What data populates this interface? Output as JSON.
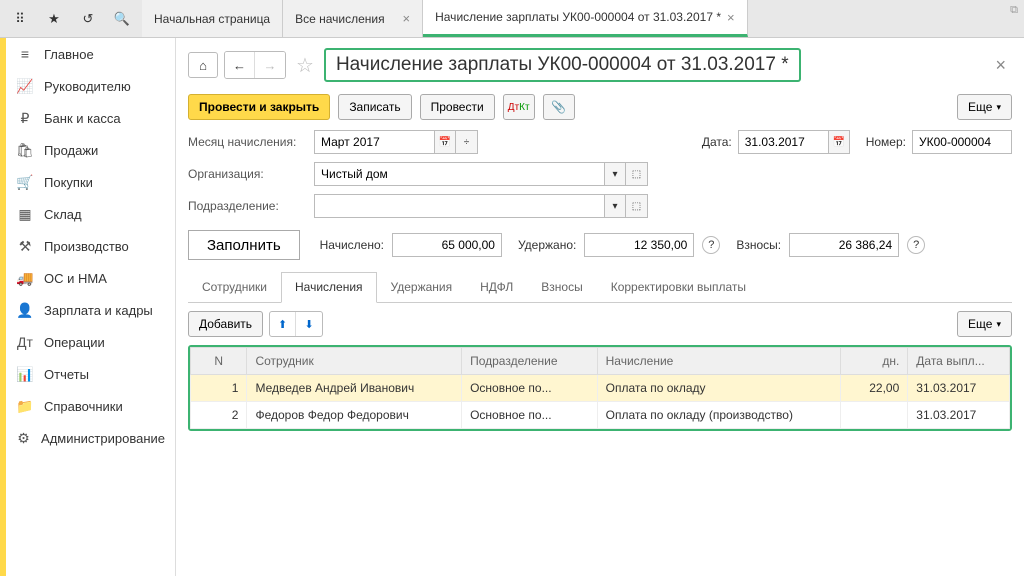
{
  "topTabs": [
    {
      "label": "Начальная страница"
    },
    {
      "label": "Все начисления"
    },
    {
      "label": "Начисление зарплаты УК00-000004 от 31.03.2017 *",
      "active": true
    }
  ],
  "sidebar": [
    {
      "icon": "≡",
      "label": "Главное"
    },
    {
      "icon": "📈",
      "label": "Руководителю"
    },
    {
      "icon": "₽",
      "label": "Банк и касса"
    },
    {
      "icon": "🛍",
      "label": "Продажи"
    },
    {
      "icon": "🛒",
      "label": "Покупки"
    },
    {
      "icon": "▦",
      "label": "Склад"
    },
    {
      "icon": "⚒",
      "label": "Производство"
    },
    {
      "icon": "🚚",
      "label": "ОС и НМА"
    },
    {
      "icon": "👤",
      "label": "Зарплата и кадры"
    },
    {
      "icon": "Дт",
      "label": "Операции"
    },
    {
      "icon": "📊",
      "label": "Отчеты"
    },
    {
      "icon": "📁",
      "label": "Справочники"
    },
    {
      "icon": "⚙",
      "label": "Администрирование"
    }
  ],
  "doc": {
    "title": "Начисление зарплаты УК00-000004 от 31.03.2017 *",
    "postAndClose": "Провести и закрыть",
    "save": "Записать",
    "post": "Провести",
    "more": "Еще",
    "monthLabel": "Месяц начисления:",
    "month": "Март 2017",
    "dateLabel": "Дата:",
    "date": "31.03.2017",
    "numLabel": "Номер:",
    "num": "УК00-000004",
    "orgLabel": "Организация:",
    "org": "Чистый дом",
    "depLabel": "Подразделение:",
    "dep": "",
    "fill": "Заполнить",
    "accruedLabel": "Начислено:",
    "accrued": "65 000,00",
    "withheldLabel": "Удержано:",
    "withheld": "12 350,00",
    "contribLabel": "Взносы:",
    "contrib": "26 386,24"
  },
  "innerTabs": [
    "Сотрудники",
    "Начисления",
    "Удержания",
    "НДФЛ",
    "Взносы",
    "Корректировки выплаты"
  ],
  "innerActive": 1,
  "add": "Добавить",
  "columns": {
    "n": "N",
    "emp": "Сотрудник",
    "dep": "Подразделение",
    "acc": "Начисление",
    "days": "дн.",
    "date": "Дата выпл..."
  },
  "rows": [
    {
      "n": "1",
      "emp": "Медведев Андрей Иванович",
      "dep": "Основное по...",
      "acc": "Оплата по окладу",
      "days": "22,00",
      "date": "31.03.2017",
      "selected": true
    },
    {
      "n": "2",
      "emp": "Федоров Федор Федорович",
      "dep": "Основное по...",
      "acc": "Оплата по окладу (производство)",
      "days": "",
      "date": "31.03.2017"
    }
  ]
}
